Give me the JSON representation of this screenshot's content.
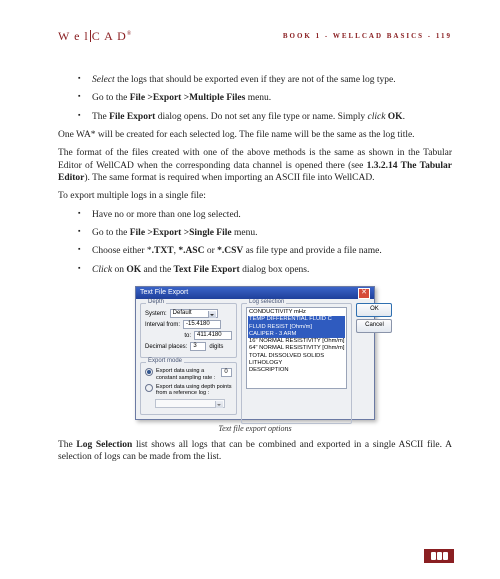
{
  "header": {
    "logo_left": "W e l",
    "logo_right": "C A D",
    "running": "BOOK 1 - WELLCAD BASICS - 119"
  },
  "bullets1": [
    {
      "pre_i": "Select",
      "rest": " the logs that should be exported even if they are not of the same log type."
    },
    {
      "plain_pre": "Go to the ",
      "b": "File >Export >Multiple Files",
      "plain_post": " menu."
    },
    {
      "plain_pre": "The ",
      "b": "File Export",
      "plain_mid": " dialog opens. Do not set any file type or name. Simply ",
      "i": "click",
      "b2": " OK",
      "plain_post": "."
    }
  ],
  "para1": "One WA* will be created for each selected log. The file name will be the same as the log title.",
  "para2": {
    "pre": "The format of the files created with one of the above methods is the same as shown in the Tabular Editor of WellCAD when the corresponding data channel is opened there (see ",
    "b": "1.3.2.14 The Tabular Editor",
    "post": "). The same format is required when importing an ASCII file into WellCAD."
  },
  "para3": "To export multiple logs in a single file:",
  "bullets2": [
    {
      "plain": "Have no or more than one log selected."
    },
    {
      "plain_pre": "Go to the ",
      "b": "File >Export >Single File",
      "plain_post": " menu."
    },
    {
      "plain_pre": "Choose either *",
      "b": ".TXT",
      "mid": ", ",
      "b2": "*.ASC",
      "mid2": " or ",
      "b3": "*.CSV",
      "plain_post": " as file type and provide a file name."
    },
    {
      "i": "Click",
      "plain_pre": " on ",
      "b": "OK",
      "mid": " and the ",
      "b2": "Text File Export",
      "plain_post": " dialog box opens."
    }
  ],
  "dialog": {
    "title": "Text File Export",
    "depth": {
      "legend": "Depth",
      "system_lab": "System:",
      "system_val": "Default",
      "from_lab": "Interval from:",
      "from_val": "-15.4180",
      "to_lab": "to:",
      "to_val": "411.4180",
      "dec_lab": "Decimal places:",
      "dec_val": "3",
      "units": "digits"
    },
    "export": {
      "legend": "Export mode",
      "opt1": "Export data using a constant sampling rate :",
      "rate": "0",
      "opt2": "Export data using depth points from a reference log :",
      "ref": ""
    },
    "logs": {
      "legend": "Log selection",
      "items": [
        "CONDUCTIVITY mHz",
        "TEMP DIFFERENTIAL FLUID C",
        "FLUID RESIST [Ohm/m]",
        "CALIPER - 3 ARM",
        "16\" NORMAL RESISTIVITY [Ohm/m]",
        "64\" NORMAL RESISTIVITY [Ohm/m]",
        "TOTAL DISSOLVED SOLIDS",
        "LITHOLOGY",
        "DESCRIPTION"
      ]
    },
    "buttons": {
      "ok": "OK",
      "cancel": "Cancel"
    }
  },
  "caption": "Text file export options",
  "para4": {
    "pre": "The ",
    "b": "Log Selection",
    "post": " list shows all logs that can be combined and exported in a single ASCII file. A selection of logs can be made from the list."
  }
}
